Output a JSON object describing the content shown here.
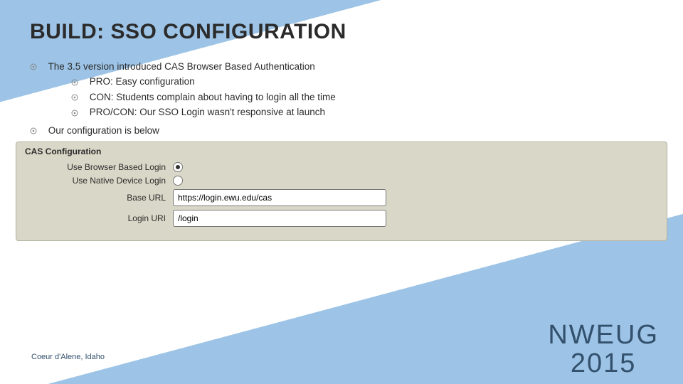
{
  "title": "BUILD: SSO CONFIGURATION",
  "bullets": {
    "b0": "The 3.5 version introduced CAS Browser Based Authentication",
    "b0_subs": {
      "s0": "PRO: Easy configuration",
      "s1": "CON: Students complain about having to login all the time",
      "s2": "PRO/CON: Our SSO Login wasn't responsive at launch"
    },
    "b1": "Our configuration is below"
  },
  "panel": {
    "heading": "CAS Configuration",
    "labels": {
      "browser": "Use Browser Based Login",
      "native": "Use Native Device Login",
      "baseurl": "Base URL",
      "loginuri": "Login URI"
    },
    "values": {
      "baseurl": "https://login.ewu.edu/cas",
      "loginuri": "/login"
    }
  },
  "footer": {
    "left": "Coeur d'Alene, Idaho",
    "right1": "NWEUG",
    "right2": "2015"
  }
}
